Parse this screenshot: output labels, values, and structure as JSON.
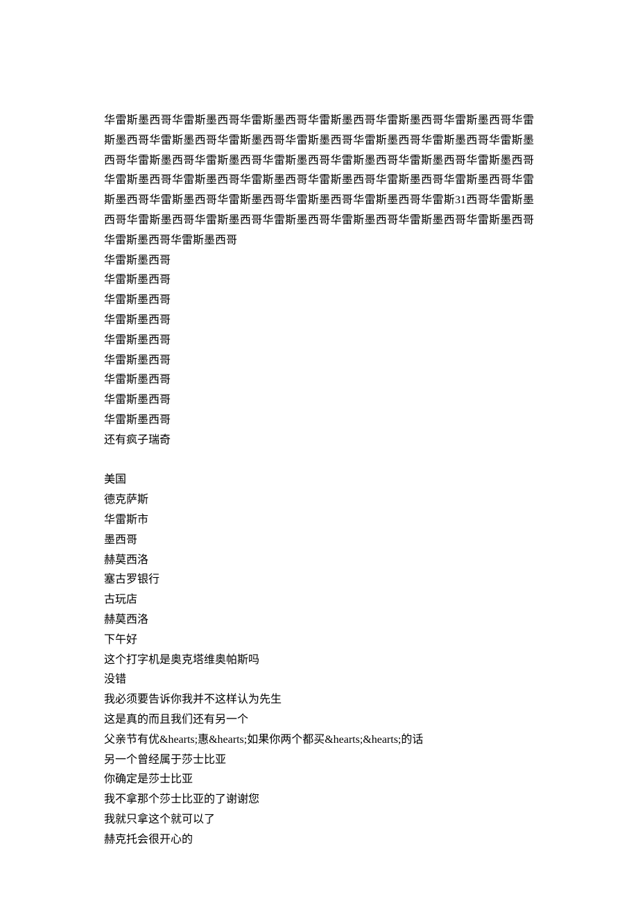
{
  "paragraph": "华雷斯墨西哥华雷斯墨西哥华雷斯墨西哥华雷斯墨西哥华雷斯墨西哥华雷斯墨西哥华雷斯墨西哥华雷斯墨西哥华雷斯墨西哥华雷斯墨西哥华雷斯墨西哥华雷斯墨西哥华雷斯墨西哥华雷斯墨西哥华雷斯墨西哥华雷斯墨西哥华雷斯墨西哥华雷斯墨西哥华雷斯墨西哥华雷斯墨西哥华雷斯墨西哥华雷斯墨西哥华雷斯墨西哥华雷斯墨西哥华雷斯墨西哥华雷斯墨西哥华雷斯墨西哥华雷斯墨西哥华雷斯墨西哥华雷斯墨西哥华雷斯31西哥华雷斯墨西哥华雷斯墨西哥华雷斯墨西哥华雷斯墨西哥华雷斯墨西哥华雷斯墨西哥华雷斯墨西哥华雷斯墨西哥华雷斯墨西哥",
  "lines_block1": [
    "华雷斯墨西哥",
    "华雷斯墨西哥",
    "华雷斯墨西哥",
    "华雷斯墨西哥",
    "华雷斯墨西哥",
    "华雷斯墨西哥",
    "华雷斯墨西哥",
    "华雷斯墨西哥",
    "华雷斯墨西哥",
    "还有疯子瑞奇"
  ],
  "lines_block2": [
    "美国",
    "德克萨斯",
    "华雷斯市",
    "墨西哥",
    "赫莫西洛",
    "塞古罗银行",
    "古玩店",
    "赫莫西洛",
    "下午好",
    "这个打字机是奥克塔维奥帕斯吗",
    "没错",
    "我必须要告诉你我并不这样认为先生",
    "这是真的而且我们还有另一个",
    "父亲节有优&hearts;惠&hearts;如果你两个都买&hearts;&hearts;的话",
    "另一个曾经属于莎士比亚",
    "你确定是莎士比亚",
    "我不拿那个莎士比亚的了谢谢您",
    "我就只拿这个就可以了",
    "赫克托会很开心的"
  ]
}
